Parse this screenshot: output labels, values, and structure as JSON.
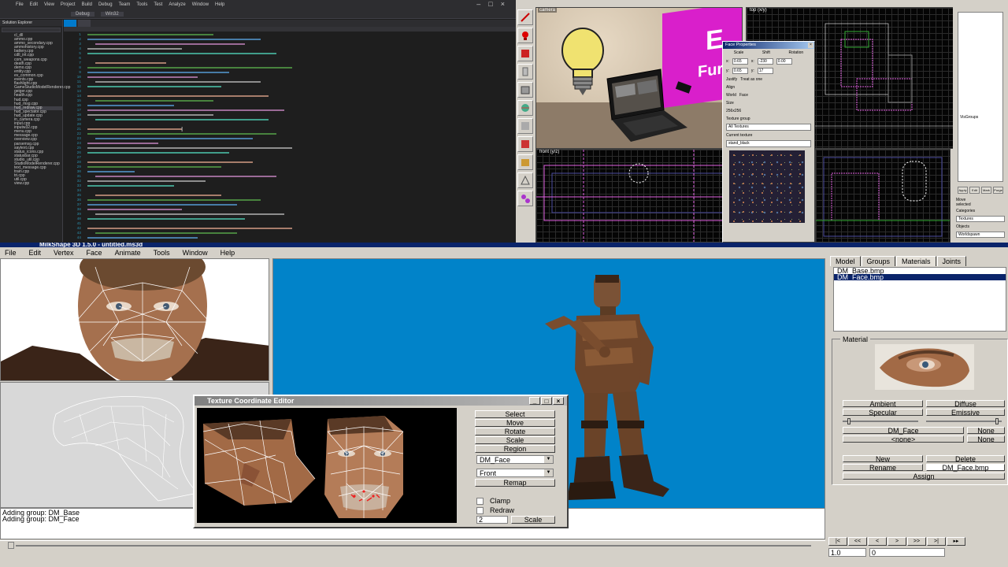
{
  "code_editor": {
    "menu": [
      "File",
      "Edit",
      "View",
      "Project",
      "Build",
      "Debug",
      "Team",
      "Tools",
      "Test",
      "Analyze",
      "Window",
      "Help"
    ],
    "toolbar": [
      "Debug",
      "Win32"
    ],
    "solution_title": "Solution Explorer",
    "tabs": [],
    "files": [
      "cl_dll",
      "ammo.cpp",
      "ammo_secondary.cpp",
      "ammohistory.cpp",
      "battery.cpp",
      "cdll_int.cpp",
      "com_weapons.cpp",
      "death.cpp",
      "demo.cpp",
      "entity.cpp",
      "ev_common.cpp",
      "events.cpp",
      "flashlight.cpp",
      "GameStudioModelRenderer.cpp",
      "geiger.cpp",
      "health.cpp",
      "hud.cpp",
      "hud_msg.cpp",
      "hud_redraw.cpp",
      "hud_spectator.cpp",
      "hud_update.cpp",
      "in_camera.cpp",
      "input.cpp",
      "inputw32.cpp",
      "menu.cpp",
      "message.cpp",
      "overview.cpp",
      "parsemsg.cpp",
      "saytext.cpp",
      "status_icons.cpp",
      "statusbar.cpp",
      "studio_util.cpp",
      "StudioModelRenderer.cpp",
      "text_message.cpp",
      "train.cpp",
      "tri.cpp",
      "util.cpp",
      "view.cpp"
    ],
    "line_numbers": [
      "1",
      "2",
      "3",
      "4",
      "5",
      "6",
      "7",
      "8",
      "9",
      "10",
      "11",
      "12",
      "13",
      "14",
      "15",
      "16",
      "17",
      "18",
      "19",
      "20",
      "21",
      "22",
      "23",
      "24",
      "25",
      "26",
      "27",
      "28",
      "29",
      "30",
      "31",
      "32",
      "33",
      "34",
      "35",
      "36",
      "37",
      "38",
      "39",
      "40",
      "41",
      "42",
      "43",
      "44"
    ]
  },
  "level_editor": {
    "viewport_labels": [
      "camera",
      "top (x/y)",
      "front (y/z)",
      ""
    ],
    "poster_text": [
      "E",
      "Fur"
    ],
    "face_properties": {
      "title": "Face Properties",
      "scale_label": "Scale",
      "shift_label": "Shift",
      "rotation_label": "Rotation",
      "x_scale": "0.65",
      "y_scale": "0.65",
      "x_shift": "-230",
      "y_shift": "17",
      "rotation": "0.00",
      "justify_label": "Justify",
      "treat_as_one": "Treat as one",
      "align_label": "Align",
      "world": "World",
      "face": "Face",
      "size_label": "Size",
      "size_value": "256x256",
      "texture_group_label": "Texture group",
      "texture_group": "All Textures",
      "current_texture_label": "Current texture",
      "current_texture": "stand_black"
    },
    "props": {
      "visgroup_label": "VisGroups",
      "buttons": [
        "Apply",
        "Edit",
        "Mark",
        "Purge"
      ],
      "move_label": "Move",
      "selected_label": "selected",
      "lists": [
        "Categories",
        "Textures",
        "Objects",
        "Worldspawn"
      ]
    }
  },
  "milkshape": {
    "title": "MilkShape 3D 1.5.0 - untitled.ms3d",
    "menu": [
      "File",
      "Edit",
      "Vertex",
      "Face",
      "Animate",
      "Tools",
      "Window",
      "Help"
    ],
    "log": [
      "Adding group: DM_Base",
      "Adding group: DM_Face"
    ],
    "texture_editor": {
      "title": "Texture Coordinate Editor",
      "window_controls": [
        "_",
        "□",
        "×"
      ],
      "buttons": [
        "Select",
        "Move",
        "Rotate",
        "Scale",
        "Region"
      ],
      "material_select": "DM_Face",
      "view_select": "Front",
      "remap": "Remap",
      "clamp": "Clamp",
      "redraw": "Redraw",
      "scale_value": "2",
      "scale_button": "Scale"
    },
    "panel": {
      "tabs": [
        "Model",
        "Groups",
        "Materials",
        "Joints"
      ],
      "active_tab": "Materials",
      "materials": [
        "DM_Base.bmp",
        "DM_Face.bmp"
      ],
      "selected_material": "DM_Face.bmp",
      "material_frame_label": "Material",
      "ambient": "Ambient",
      "diffuse": "Diffuse",
      "specular": "Specular",
      "emissive": "Emissive",
      "texture_button": "DM_Face",
      "none_button": "<none>",
      "none_right_1": "None",
      "none_right_2": "None",
      "new": "New",
      "delete": "Delete",
      "rename": "Rename",
      "texture_file": "DM_Face.bmp",
      "assign": "Assign",
      "nav": [
        "|<",
        "<<",
        "<",
        ">",
        ">>",
        ">|",
        "▸▸"
      ],
      "frame_a": "1.0",
      "frame_b": "0"
    }
  }
}
